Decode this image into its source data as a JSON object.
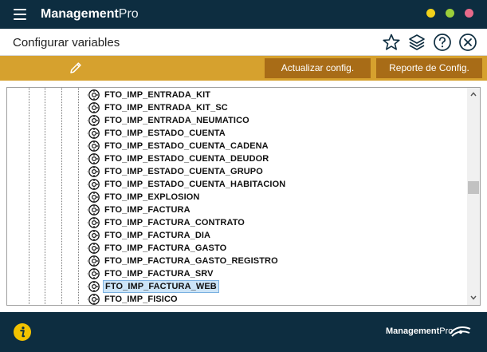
{
  "app": {
    "title_bold": "Management",
    "title_light": "Pro"
  },
  "window_controls": {
    "minimize_color": "#f2d21b",
    "maximize_color": "#9ccf3a",
    "close_color": "#e86a8a"
  },
  "header": {
    "title": "Configurar variables",
    "icons": [
      "star-icon",
      "layers-icon",
      "help-icon",
      "close-icon"
    ]
  },
  "toolbar": {
    "edit_icon": "pencil-icon",
    "update_label": "Actualizar config.",
    "report_label": "Reporte de Config."
  },
  "tree": {
    "items": [
      {
        "label": "FTO_IMP_ENTRADA_KIT"
      },
      {
        "label": "FTO_IMP_ENTRADA_KIT_SC"
      },
      {
        "label": "FTO_IMP_ENTRADA_NEUMATICO"
      },
      {
        "label": "FTO_IMP_ESTADO_CUENTA"
      },
      {
        "label": "FTO_IMP_ESTADO_CUENTA_CADENA"
      },
      {
        "label": "FTO_IMP_ESTADO_CUENTA_DEUDOR"
      },
      {
        "label": "FTO_IMP_ESTADO_CUENTA_GRUPO"
      },
      {
        "label": "FTO_IMP_ESTADO_CUENTA_HABITACION"
      },
      {
        "label": "FTO_IMP_EXPLOSION"
      },
      {
        "label": "FTO_IMP_FACTURA"
      },
      {
        "label": "FTO_IMP_FACTURA_CONTRATO"
      },
      {
        "label": "FTO_IMP_FACTURA_DIA"
      },
      {
        "label": "FTO_IMP_FACTURA_GASTO"
      },
      {
        "label": "FTO_IMP_FACTURA_GASTO_REGISTRO"
      },
      {
        "label": "FTO_IMP_FACTURA_SRV"
      },
      {
        "label": "FTO_IMP_FACTURA_WEB",
        "selected": true
      },
      {
        "label": "FTO_IMP_FISICO"
      }
    ]
  },
  "footer": {
    "info_icon": "info-icon",
    "brand_bold": "Management",
    "brand_light": "Pro"
  },
  "colors": {
    "titlebar": "#0d2d40",
    "toolbar": "#d6a12e",
    "toolbar_button": "#a86c17",
    "selection": "#cce4f7",
    "info": "#f2c200"
  }
}
